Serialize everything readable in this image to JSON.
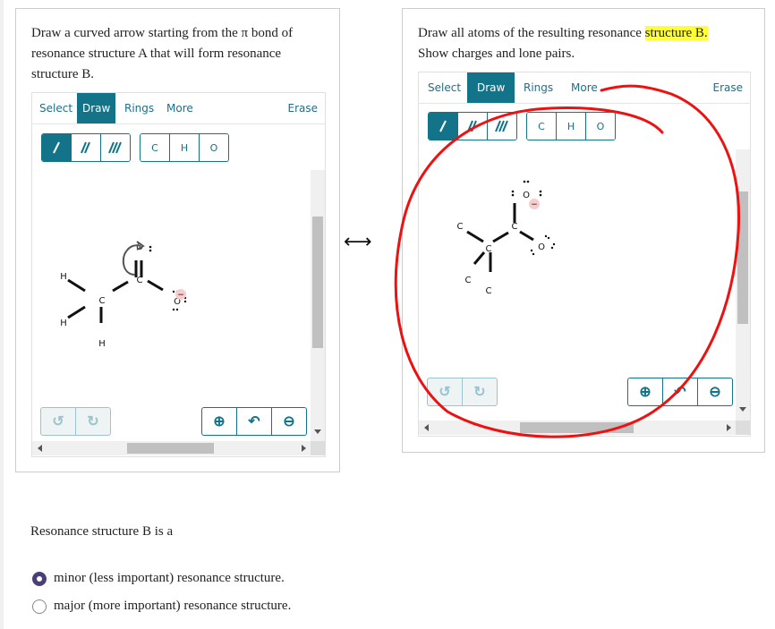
{
  "part_a": {
    "prompt": "Draw a curved arrow starting from the π bond of resonance structure A that will form resonance structure B.",
    "toolbar": {
      "tabs": [
        "Select",
        "Draw",
        "Rings",
        "More"
      ],
      "active_tab": "Draw",
      "erase": "Erase"
    },
    "bond_buttons": [
      "single-bond",
      "double-bond",
      "triple-bond"
    ],
    "atom_buttons": [
      "C",
      "H",
      "O"
    ],
    "molecule": {
      "atoms": [
        "H",
        "H",
        "H",
        "C",
        "C",
        "O",
        "O"
      ],
      "charge": "−"
    },
    "controls": {
      "undo": "undo",
      "redo": "redo",
      "zoom_in": "zoom-in",
      "reset": "reset",
      "zoom_out": "zoom-out"
    }
  },
  "resonance_arrow": "⟷",
  "part_b": {
    "prompt_line1": "Draw all atoms of the resulting resonance ",
    "prompt_highlight": "structure B.",
    "prompt_line2": "Show charges and lone pairs.",
    "toolbar": {
      "tabs": [
        "Select",
        "Draw",
        "Rings",
        "More"
      ],
      "active_tab": "Draw",
      "erase": "Erase"
    },
    "bond_buttons": [
      "single-bond",
      "double-bond",
      "triple-bond"
    ],
    "atom_buttons": [
      "C",
      "H",
      "O"
    ],
    "molecule": {
      "atoms": [
        "C",
        "C",
        "C",
        "C",
        "C",
        "O",
        "O"
      ],
      "charge": "−"
    },
    "annotation_color": "#ee1111"
  },
  "question": {
    "text": "Resonance structure B is a",
    "options": [
      {
        "label": "minor (less important) resonance structure.",
        "selected": true
      },
      {
        "label": "major (more important) resonance structure.",
        "selected": false
      }
    ]
  },
  "colors": {
    "accent": "#137389",
    "radio": "#4b3f7a",
    "highlight": "#ffff33",
    "charge_bg": "#f8cccc"
  }
}
